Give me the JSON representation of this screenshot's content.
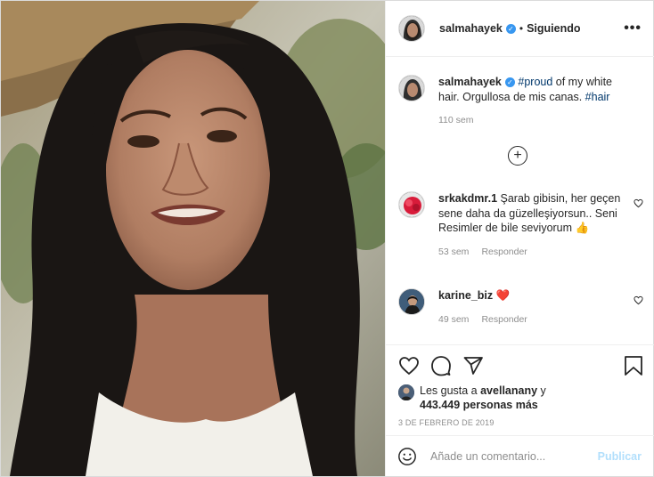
{
  "post": {
    "username": "salmahayek",
    "follow_status": "Siguiendo",
    "separator": "•",
    "more_label": "•••"
  },
  "caption": {
    "username": "salmahayek",
    "tag1": "#proud",
    "text1": " of my white hair. Orgullosa de mis canas. ",
    "tag2": "#hair",
    "age": "110 sem"
  },
  "load_more_label": "+",
  "comments": [
    {
      "username": "srkakdmr.1",
      "text": " Şarab gibisin, her geçen sene daha da güzelleşiyorsun.. Seni Resimler de bile seviyorum ",
      "emoji": "👍",
      "age": "53 sem",
      "reply_label": "Responder"
    },
    {
      "username": "karine_biz",
      "text": " ",
      "emoji": "❤️",
      "age": "49 sem",
      "reply_label": "Responder"
    }
  ],
  "likes": {
    "prefix": "Les gusta a ",
    "user": "avellanany",
    "connector": " y",
    "count": "443.449 personas más"
  },
  "date": "3 DE FEBRERO DE 2019",
  "comment_box": {
    "placeholder": "Añade un comentario...",
    "publish_label": "Publicar"
  },
  "icons": {
    "more": "more-options-icon",
    "verified": "verified-badge-icon",
    "like": "heart-icon",
    "comment": "comment-bubble-icon",
    "share": "paper-plane-icon",
    "save": "bookmark-icon",
    "emoji": "emoji-smile-icon"
  },
  "colors": {
    "verified_blue": "#3897f0",
    "hashtag": "#00376b",
    "muted": "#8e8e8e",
    "publish_disabled": "#b2dffc",
    "heart_red": "#ed4956"
  }
}
